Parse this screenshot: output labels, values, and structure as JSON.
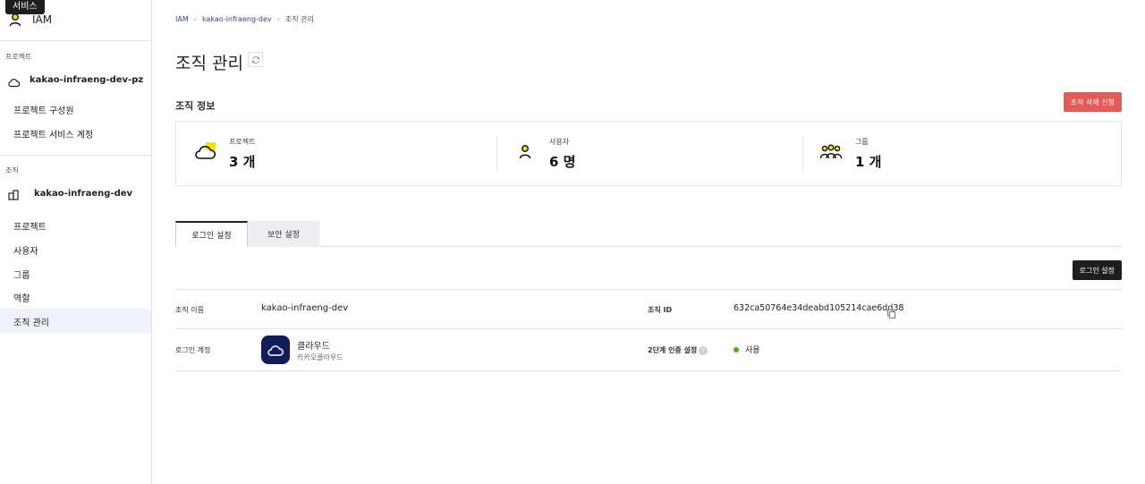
{
  "tooltip": "서비스",
  "sidebar": {
    "app_title": "IAM",
    "project_section_label": "프로젝트",
    "project_selector": "kakao-infraeng-dev-pz",
    "project_links": [
      "프로젝트 구성원",
      "프로젝트 서비스 계정"
    ],
    "org_section_label": "조직",
    "org_selector": "kakao-infraeng-dev",
    "org_items": [
      "프로젝트",
      "사용자",
      "그룹",
      "역할",
      "조직 관리"
    ],
    "active_item": "조직 관리"
  },
  "breadcrumb": [
    "IAM",
    "kakao-infraeng-dev",
    "조직 관리"
  ],
  "page_title": "조직 관리",
  "org_info": {
    "section_title": "조직 정보",
    "delete_button": "조직 삭제 신청",
    "stats": [
      {
        "label": "프로젝트",
        "value": "3 개",
        "icon": "cloud-icon"
      },
      {
        "label": "사용자",
        "value": "6 명",
        "icon": "user-icon"
      },
      {
        "label": "그룹",
        "value": "1 개",
        "icon": "group-icon"
      }
    ]
  },
  "tabs": [
    "로그인 설정",
    "보안 설정"
  ],
  "login_settings_button": "로그인 설정",
  "details": {
    "org_name_label": "조직 이름",
    "org_name_value": "kakao-infraeng-dev",
    "org_id_label": "조직 ID",
    "org_id_value": "632ca50764e34deabd105214cae6dd38",
    "login_account_label": "로그인 계정",
    "login_account_name": "클라우드",
    "login_account_sub": "카카오클라우드",
    "two_factor_label": "2단계 인증 설정",
    "two_factor_value": "사용"
  },
  "colors": {
    "accent_yellow": "#fae100",
    "danger": "#e35b57",
    "status_on": "#4caf1f",
    "badge_navy": "#0f1d5a"
  }
}
